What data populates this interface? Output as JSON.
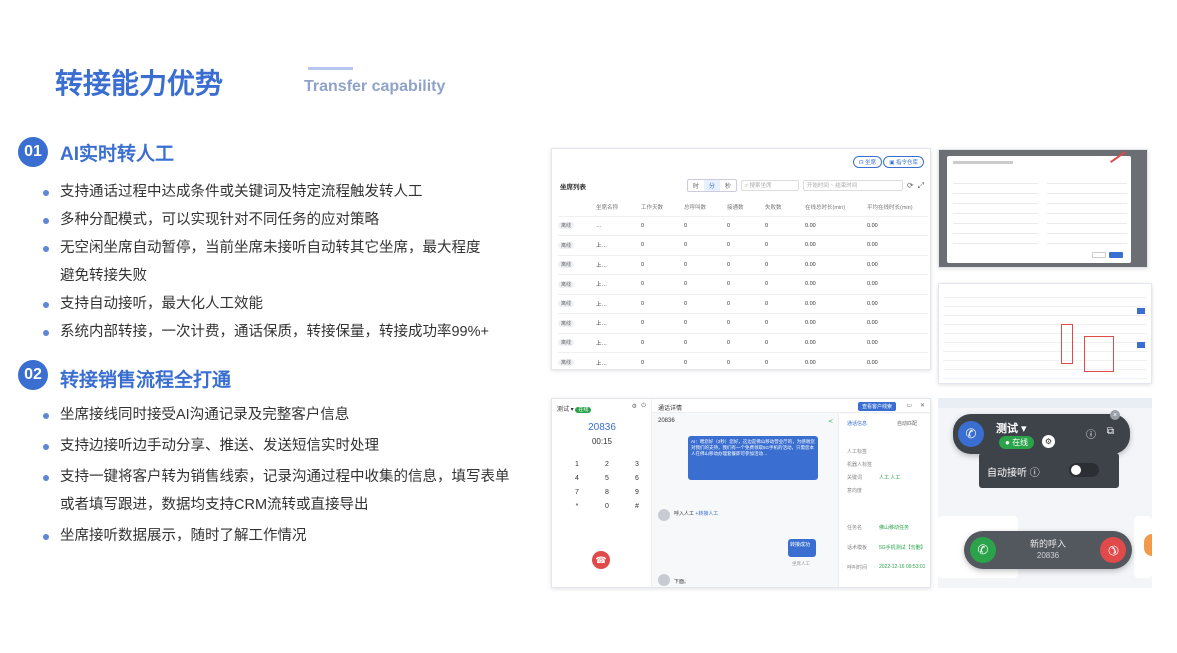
{
  "page": {
    "title": "转接能力优势",
    "subtitle": "Transfer capability"
  },
  "sections": [
    {
      "num": "01",
      "title": "AI实时转人工",
      "bullets": [
        "支持通话过程中达成条件或关键词及特定流程触发转人工",
        "多种分配模式，可以实现针对不同任务的应对策略",
        "无空闲坐席自动暂停，当前坐席未接听自动转其它坐席，最大程度",
        "支持自动接听，最大化人工效能",
        "系统内部转接，一次计费，通话保质，转接保量，转接成功率99%+"
      ],
      "bullet3_cont": "避免转接失败"
    },
    {
      "num": "02",
      "title": "转接销售流程全打通",
      "bullets": [
        "坐席接线同时接受AI沟通记录及完整客户信息",
        "支持边接听边手动分享、推送、发送短信实时处理",
        "支持一键将客户转为销售线索，记录沟通过程中收集的信息，填写表单",
        "坐席接听数据展示，随时了解工作情况"
      ],
      "bullet3_cont": "或者填写跟进，数据均支持CRM流转或直接导出"
    }
  ],
  "seat_list": {
    "title": "坐席列表",
    "btn_seat": "坐席",
    "btn_guide": "指令仓库",
    "seg": [
      "时",
      "分",
      "秒"
    ],
    "search_placeholder": "搜索坐席",
    "start_placeholder": "开始时间",
    "end_placeholder": "结束时间",
    "columns": [
      "",
      "坐席名称",
      "工作天数",
      "总呼叫数",
      "接通数",
      "失败数",
      "在线总时长(min)",
      "平均在线时长(min)"
    ],
    "rows": [
      {
        "status": "离线",
        "name": "…",
        "v": [
          "0",
          "0",
          "0",
          "0",
          "0.00",
          "0.00"
        ]
      },
      {
        "status": "离线",
        "name": "上…",
        "v": [
          "0",
          "0",
          "0",
          "0",
          "0.00",
          "0.00"
        ]
      },
      {
        "status": "离线",
        "name": "上…",
        "v": [
          "0",
          "0",
          "0",
          "0",
          "0.00",
          "0.00"
        ]
      },
      {
        "status": "离线",
        "name": "上…",
        "v": [
          "0",
          "0",
          "0",
          "0",
          "0.00",
          "0.00"
        ]
      },
      {
        "status": "离线",
        "name": "上…",
        "v": [
          "0",
          "0",
          "0",
          "0",
          "0.00",
          "0.00"
        ]
      },
      {
        "status": "离线",
        "name": "上…",
        "v": [
          "0",
          "0",
          "0",
          "0",
          "0.00",
          "0.00"
        ]
      },
      {
        "status": "离线",
        "name": "上…",
        "v": [
          "0",
          "0",
          "0",
          "0",
          "0.00",
          "0.00"
        ]
      },
      {
        "status": "离线",
        "name": "上…",
        "v": [
          "0",
          "0",
          "0",
          "0",
          "0.00",
          "0.00"
        ]
      }
    ]
  },
  "dialer": {
    "status_label": "测试",
    "online": "在线",
    "number": "20836",
    "timer": "00:15",
    "keys": [
      "1",
      "2",
      "3",
      "4",
      "5",
      "6",
      "7",
      "8",
      "9",
      "*",
      "0",
      "#"
    ]
  },
  "call_detail": {
    "title": "通话详情",
    "btn": "查看客户线索",
    "number": "20836",
    "tabs_right": [
      "通话信息",
      "自动匹配"
    ],
    "ai_text": "AI：喂您好（2秒）您好，这边是佛山移动营业厅的，为感谢您对我们的支持，我们有一个免费领取5G手机的活动，只需您本人在佛山移动办理套餐即可参加活动…",
    "customer_label": "呼入人工",
    "customer_sub": "+转接人工",
    "bubble_label": "转接成功",
    "agent_label": "坐席人工",
    "last_label": "下面。",
    "fields": [
      {
        "k": "人工标签",
        "v": ""
      },
      {
        "k": "机器人标签",
        "v": ""
      },
      {
        "k": "关键词",
        "v": "人工 人工"
      },
      {
        "k": "意向度",
        "v": ""
      }
    ],
    "task_fields": [
      {
        "k": "任务名",
        "v": "佛山移动任务"
      },
      {
        "k": "话术模板",
        "v": "5G手机测试【勿删】"
      },
      {
        "k": "呼叫时间",
        "v": "2022-12-16 09:53:01"
      }
    ]
  },
  "widgets": {
    "agent_name": "测试",
    "online": "在线",
    "auto_answer": "自动接听",
    "new_call": "新的呼入",
    "new_call_number": "20836"
  },
  "colors": {
    "accent": "#3a6fd1",
    "red": "#e04a4a",
    "green": "#2aa34a",
    "dark": "#3e4349"
  }
}
